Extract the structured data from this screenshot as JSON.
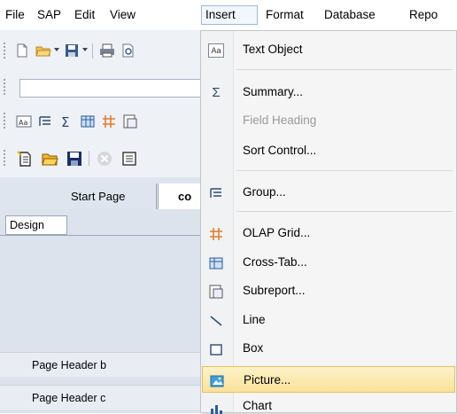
{
  "menubar": {
    "items": [
      "File",
      "SAP",
      "Edit",
      "View",
      "Insert",
      "Format",
      "Database",
      "Repo"
    ],
    "active": "Insert"
  },
  "tabs": {
    "start_page": "Start Page",
    "partial_tab": "co"
  },
  "design": {
    "tab_label": "Design",
    "sections": [
      "Page Header b",
      "Page Header c"
    ]
  },
  "insert_menu": {
    "items": [
      {
        "label": "Text Object",
        "icon": "text-object-icon",
        "disabled": false
      },
      {
        "label": "Summary...",
        "icon": "summary-sigma-icon",
        "disabled": false
      },
      {
        "label": "Field Heading",
        "icon": "",
        "disabled": true
      },
      {
        "label": "Sort Control...",
        "icon": "",
        "disabled": false
      },
      {
        "label": "Group...",
        "icon": "group-icon",
        "disabled": false
      },
      {
        "label": "OLAP Grid...",
        "icon": "olap-grid-icon",
        "disabled": false
      },
      {
        "label": "Cross-Tab...",
        "icon": "cross-tab-icon",
        "disabled": false
      },
      {
        "label": "Subreport...",
        "icon": "subreport-icon",
        "disabled": false
      },
      {
        "label": "Line",
        "icon": "line-icon",
        "disabled": false
      },
      {
        "label": "Box",
        "icon": "box-icon",
        "disabled": false
      },
      {
        "label": "Picture...",
        "icon": "picture-icon",
        "disabled": false,
        "highlighted": true
      },
      {
        "label": "Chart",
        "icon": "chart-icon",
        "disabled": false
      }
    ]
  },
  "colors": {
    "highlight": "#fbe19a",
    "menu_bg": "#f5f5f5",
    "toolbar_bg": "#eef1f6"
  }
}
